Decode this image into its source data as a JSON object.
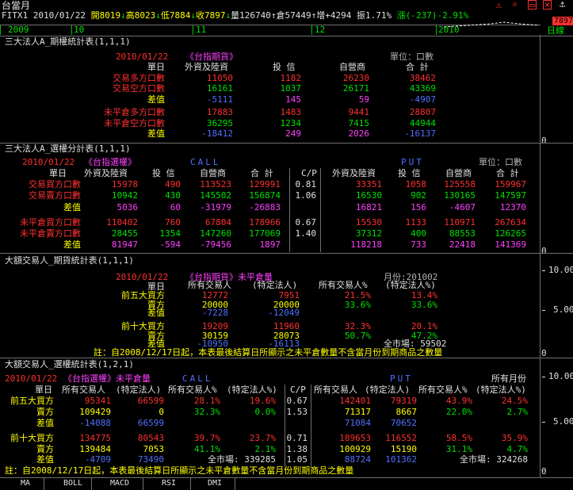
{
  "header": {
    "title": "台當月",
    "symbol": "FITX1",
    "date": "2010/01/22",
    "open": "開8019",
    "high": "高8023",
    "low": "低7884",
    "close": "收7897",
    "volume": "量126740",
    "oi": "倉57449",
    "oi_change": "增+4294",
    "amplitude": "振1.71%",
    "change": "漲(-237)-2.91%",
    "price_tag": "7897",
    "timeline": [
      "2009",
      "10",
      "11",
      "12",
      "2010"
    ],
    "daily": "日線"
  },
  "sec1": {
    "title": "三大法人A_期權統計表(1,1,1)",
    "date": "2010/01/22",
    "product": "《台指期貨》",
    "unit": "單位：口數",
    "col_head": "單日",
    "cols": [
      "外資及陸資",
      "投  信",
      "自營商",
      "合  計"
    ],
    "rows": [
      {
        "label": "交易多方口數",
        "v": [
          "11050",
          "1182",
          "26230",
          "38462"
        ]
      },
      {
        "label": "交易空方口數",
        "v": [
          "16161",
          "1037",
          "26171",
          "43369"
        ]
      },
      {
        "label": "差值",
        "v": [
          "-5111",
          "145",
          "59",
          "-4907"
        ]
      },
      {
        "label": "未平倉多方口數",
        "v": [
          "17883",
          "1483",
          "9441",
          "28807"
        ]
      },
      {
        "label": "未平倉空方口數",
        "v": [
          "36295",
          "1234",
          "7415",
          "44944"
        ]
      },
      {
        "label": "差值",
        "v": [
          "-18412",
          "249",
          "2026",
          "-16137"
        ]
      }
    ]
  },
  "sec2": {
    "title": "三大法人A_選權分計表(1,1,1)",
    "date": "2010/01/22",
    "product": "《台指選權》",
    "call": "CALL",
    "put": "PUT",
    "unit": "單位：口數",
    "col_head": "單日",
    "cols": [
      "外資及陸資",
      "投  信",
      "自營商",
      "合  計",
      "C/P",
      "外資及陸資",
      "投  信",
      "自營商",
      "合  計"
    ],
    "rows": [
      {
        "label": "交易買方口數",
        "v": [
          "15978",
          "490",
          "113523",
          "129991",
          "0.81",
          "33351",
          "1058",
          "125558",
          "159967"
        ]
      },
      {
        "label": "交易賣方口數",
        "v": [
          "10942",
          "430",
          "145502",
          "156874",
          "1.06",
          "16530",
          "902",
          "130165",
          "147597"
        ]
      },
      {
        "label": "差值",
        "v": [
          "5036",
          "60",
          "-31979",
          "-26883",
          "",
          "16821",
          "156",
          "-4607",
          "12370"
        ]
      },
      {
        "label": "未平倉買方口數",
        "v": [
          "110402",
          "760",
          "67804",
          "178966",
          "0.67",
          "15530",
          "1133",
          "110971",
          "267634"
        ]
      },
      {
        "label": "未平倉賣方口數",
        "v": [
          "28455",
          "1354",
          "147260",
          "177069",
          "1.40",
          "37312",
          "400",
          "88553",
          "126265"
        ]
      },
      {
        "label": "差值",
        "v": [
          "81947",
          "-594",
          "-79456",
          "1897",
          "",
          "118218",
          "733",
          "22418",
          "141369"
        ]
      }
    ]
  },
  "sec3": {
    "title": "大額交易人_期貨統計表(1,1,1)",
    "date": "2010/01/22",
    "product": "《台指期貨》未平倉量",
    "month": "月份:201002",
    "col_head": "單日",
    "cols": [
      "所有交易人",
      "(特定法人)",
      "所有交易人%",
      "(特定法人%)"
    ],
    "rows": [
      {
        "label": "前五大買方",
        "v": [
          "12772",
          "7951",
          "21.5%",
          "13.4%"
        ]
      },
      {
        "label": "賣方",
        "v": [
          "20000",
          "20000",
          "33.6%",
          "33.6%"
        ]
      },
      {
        "label": "差值",
        "v": [
          "-7228",
          "-12049",
          "",
          ""
        ]
      },
      {
        "label": "前十大買方",
        "v": [
          "19209",
          "11960",
          "32.3%",
          "20.1%"
        ]
      },
      {
        "label": "賣方",
        "v": [
          "30159",
          "28073",
          "50.7%",
          "47.2%"
        ]
      },
      {
        "label": "差值",
        "v": [
          "-10950",
          "-16113",
          "",
          ""
        ]
      }
    ],
    "market": "全市場:",
    "market_val": "59502",
    "note": "註：自2008/12/17日起，本表最後結算日所顯示之未平倉數量不含當月份到期商品之數量",
    "axis": [
      "10.00",
      "5.00",
      "0"
    ]
  },
  "sec4": {
    "title": "大額交易人_選權統計表(1,2,1)",
    "date": "2010/01/22",
    "product": "《台指選權》未平倉量",
    "call": "CALL",
    "put": "PUT",
    "month": "所有月份",
    "col_head": "單日",
    "cols": [
      "所有交易人",
      "(特定法人)",
      "所有交易人%",
      "(特定法人%)",
      "C/P",
      "所有交易人",
      "(特定法人)",
      "所有交易人%",
      "(特定法人%)"
    ],
    "rows": [
      {
        "label": "前五大買方",
        "v": [
          "95341",
          "66599",
          "28.1%",
          "19.6%",
          "0.67",
          "142401",
          "79319",
          "43.9%",
          "24.5%"
        ]
      },
      {
        "label": "賣方",
        "v": [
          "109429",
          "0",
          "32.3%",
          "0.0%",
          "1.53",
          "71317",
          "8667",
          "22.0%",
          "2.7%"
        ]
      },
      {
        "label": "差值",
        "v": [
          "-14088",
          "66599",
          "",
          "",
          "",
          "71084",
          "70652",
          "",
          ""
        ]
      },
      {
        "label": "前十大買方",
        "v": [
          "134775",
          "80543",
          "39.7%",
          "23.7%",
          "0.71",
          "189653",
          "116552",
          "58.5%",
          "35.9%"
        ]
      },
      {
        "label": "賣方",
        "v": [
          "139484",
          "7053",
          "41.1%",
          "2.1%",
          "1.38",
          "100929",
          "15190",
          "31.1%",
          "4.7%"
        ]
      },
      {
        "label": "差值",
        "v": [
          "-4709",
          "73490",
          "",
          "",
          "",
          "88724",
          "101362",
          "",
          ""
        ]
      }
    ],
    "market_call": "全市場: 339285",
    "cp_total": "1.05",
    "market_put": "全市場: 324268",
    "note": "註：自2008/12/17日起，本表最後結算日所顯示之未平倉數量不含當月份到期商品之數量",
    "axis": [
      "10.00",
      "5.00",
      "0"
    ]
  },
  "tabs": [
    "MA",
    "BOLL",
    "MACD",
    "RSI",
    "DMI"
  ]
}
